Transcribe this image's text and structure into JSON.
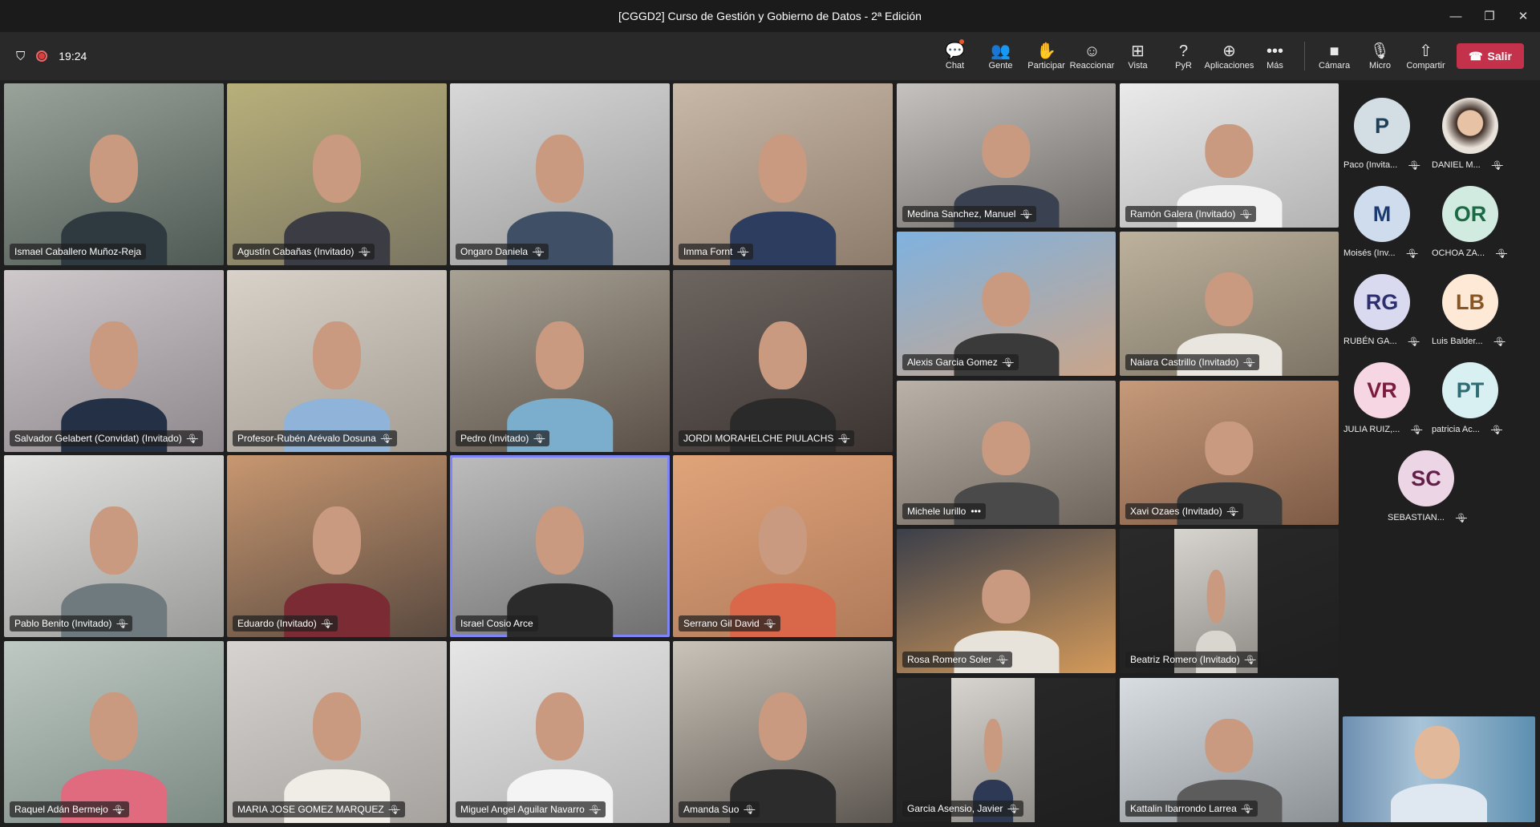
{
  "window": {
    "title": "[CGGD2] Curso de Gestión y Gobierno de Datos - 2ª Edición",
    "minimize": "—",
    "maximize": "❐",
    "close": "✕"
  },
  "meeting": {
    "timer": "19:24"
  },
  "toolbar": [
    {
      "label": "Chat",
      "icon": "chat-icon",
      "glyph": "💬",
      "badge": true
    },
    {
      "label": "Gente",
      "icon": "people-icon",
      "glyph": "👥"
    },
    {
      "label": "Participar",
      "icon": "raise-hand-icon",
      "glyph": "✋"
    },
    {
      "label": "Reaccionar",
      "icon": "smiley-icon",
      "glyph": "☺"
    },
    {
      "label": "Vista",
      "icon": "grid-view-icon",
      "glyph": "⊞"
    },
    {
      "label": "PyR",
      "icon": "qna-icon",
      "glyph": "?"
    },
    {
      "label": "Aplicaciones",
      "icon": "apps-icon",
      "glyph": "⊕"
    },
    {
      "label": "Más",
      "icon": "more-icon",
      "glyph": "•••"
    },
    {
      "sep": true
    },
    {
      "label": "Cámara",
      "icon": "camera-icon",
      "glyph": "■"
    },
    {
      "label": "Micro",
      "icon": "microphone-icon",
      "glyph": "🎙"
    },
    {
      "label": "Compartir",
      "icon": "share-screen-icon",
      "glyph": "⇧"
    }
  ],
  "leave_label": "Salir",
  "colors": {
    "leave": "#c4314b",
    "active_speaker": "#7f85f5"
  },
  "tiles": [
    {
      "name": "Ismael Caballero Muñoz-Reja",
      "muted": false,
      "bg": [
        "#9aa39a",
        "#4f5a55"
      ],
      "shirt": "#2f3a40"
    },
    {
      "name": "Agustín Cabañas (Invitado)",
      "muted": true,
      "bg": [
        "#b8b07a",
        "#7a7562"
      ],
      "shirt": "#3c3c44"
    },
    {
      "name": "Ongaro Daniela",
      "muted": true,
      "bg": [
        "#d8d8d8",
        "#9a9a9a"
      ],
      "shirt": "#3e4f66"
    },
    {
      "name": "Imma Fornt",
      "muted": true,
      "bg": [
        "#c9b9a8",
        "#8d7b6b"
      ],
      "shirt": "#2d3d60"
    },
    {
      "name": "Salvador Gelabert (Convidat) (Invitado)",
      "muted": true,
      "bg": [
        "#cfc9cc",
        "#8e878c"
      ],
      "shirt": "#233046"
    },
    {
      "name": "Profesor-Rubén Arévalo Dosuna",
      "muted": true,
      "bg": [
        "#d9d2c9",
        "#a39c93"
      ],
      "shirt": "#8fb3d9"
    },
    {
      "name": "Pedro (Invitado)",
      "muted": true,
      "bg": [
        "#a8a294",
        "#5b5048"
      ],
      "shirt": "#7aaecc"
    },
    {
      "name": "JORDI MORAHELCHE PIULACHS",
      "muted": true,
      "bg": [
        "#6d6560",
        "#3b3431"
      ],
      "shirt": "#2a2a2a"
    },
    {
      "name": "Pablo Benito (Invitado)",
      "muted": true,
      "bg": [
        "#e2e2e0",
        "#9a9a98"
      ],
      "shirt": "#6f7a7e"
    },
    {
      "name": "Eduardo (Invitado)",
      "muted": true,
      "bg": [
        "#c89770",
        "#5a4a40"
      ],
      "shirt": "#7a2b33"
    },
    {
      "name": "Israel Cosio Arce",
      "muted": false,
      "active": true,
      "bg": [
        "#bdbdbd",
        "#6f6f6f"
      ],
      "shirt": "#2b2b2b"
    },
    {
      "name": "Serrano Gil David",
      "muted": true,
      "bg": [
        "#e0a47a",
        "#b07a5a"
      ],
      "shirt": "#d9674a"
    },
    {
      "name": "Raquel Adán Bermejo",
      "muted": true,
      "bg": [
        "#bfc9c4",
        "#7c8a84"
      ],
      "shirt": "#e06a7e"
    },
    {
      "name": "MARIA JOSE GOMEZ MARQUEZ",
      "muted": true,
      "bg": [
        "#d6d3d0",
        "#a6a39f"
      ],
      "shirt": "#f0ece6"
    },
    {
      "name": "Miguel Angel Aguilar Navarro",
      "muted": true,
      "bg": [
        "#e6e6e6",
        "#b4b4b4"
      ],
      "shirt": "#f4f4f4"
    },
    {
      "name": "Amanda Suo",
      "muted": true,
      "bg": [
        "#c9c3b9",
        "#5c5650"
      ],
      "shirt": "#2c2c2c"
    },
    {
      "name": "Medina Sanchez, Manuel",
      "muted": true,
      "bg": [
        "#c5c2bf",
        "#6e6a67"
      ],
      "shirt": "#3a4150"
    },
    {
      "name": "Ramón Galera (Invitado)",
      "muted": true,
      "bg": [
        "#eaeaea",
        "#b3b3b3"
      ],
      "shirt": "#f2f2f2"
    },
    {
      "name": "Alexis Garcia Gomez",
      "muted": true,
      "bg": [
        "#7fb2e0",
        "#c9a58a"
      ],
      "shirt": "#3a3a3a"
    },
    {
      "name": "Naiara Castrillo (Invitado)",
      "muted": true,
      "bg": [
        "#bdb29c",
        "#7d7466"
      ],
      "shirt": "#e9e6e0"
    },
    {
      "name": "Michele Iurillo",
      "muted": false,
      "more": "•••",
      "bg": [
        "#bab2a8",
        "#6e655d"
      ],
      "shirt": "#4a4a4a"
    },
    {
      "name": "Xavi Ozaes (Invitado)",
      "muted": true,
      "bg": [
        "#c69a7a",
        "#7d5a45"
      ],
      "shirt": "#3c3c3c"
    },
    {
      "name": "Rosa Romero Soler",
      "muted": true,
      "bg": [
        "#3b3f4a",
        "#d49a5a"
      ],
      "shirt": "#e8e3da"
    },
    {
      "name": "Beatriz Romero (Invitado)",
      "muted": true,
      "bg": [
        "#2a2a2a",
        "#1f1f1f"
      ],
      "shirt": "#d9d5cf",
      "inset": true
    },
    {
      "name": "Garcia Asensio, Javier",
      "muted": true,
      "bg": [
        "#2a2a2a",
        "#1f1f1f"
      ],
      "shirt": "#2e3a55",
      "inset": true
    },
    {
      "name": "Kattalin Ibarrondo Larrea",
      "muted": true,
      "bg": [
        "#d8dde2",
        "#8c9196"
      ],
      "shirt": "#5c5c5c"
    }
  ],
  "roster": [
    {
      "initials": "P",
      "name": "Paco (Invita...",
      "bg": "#d3dde4",
      "fg": "#1e3f55"
    },
    {
      "initials": "",
      "name": "DANIEL M...",
      "bg": "#c9a68a",
      "fg": "#333",
      "photo": true
    },
    {
      "initials": "M",
      "name": "Moisés (Inv...",
      "bg": "#cfdcee",
      "fg": "#1c3b70"
    },
    {
      "initials": "OR",
      "name": "OCHOA ZA...",
      "bg": "#d2ebe0",
      "fg": "#1c6a45"
    },
    {
      "initials": "RG",
      "name": "RUBÉN GA...",
      "bg": "#d9d9ef",
      "fg": "#2e2f6e"
    },
    {
      "initials": "LB",
      "name": "Luis Balder...",
      "bg": "#fde9d6",
      "fg": "#8a5524"
    },
    {
      "initials": "VR",
      "name": "JULIA RUIZ,...",
      "bg": "#f6d6e2",
      "fg": "#7a1c3e"
    },
    {
      "initials": "PT",
      "name": "patricia Ac...",
      "bg": "#d9f0f3",
      "fg": "#2f6b73"
    },
    {
      "initials": "SC",
      "name": "SEBASTIAN...",
      "bg": "#ecd5e4",
      "fg": "#641e4a"
    }
  ],
  "mic_off_glyph": "🎙"
}
